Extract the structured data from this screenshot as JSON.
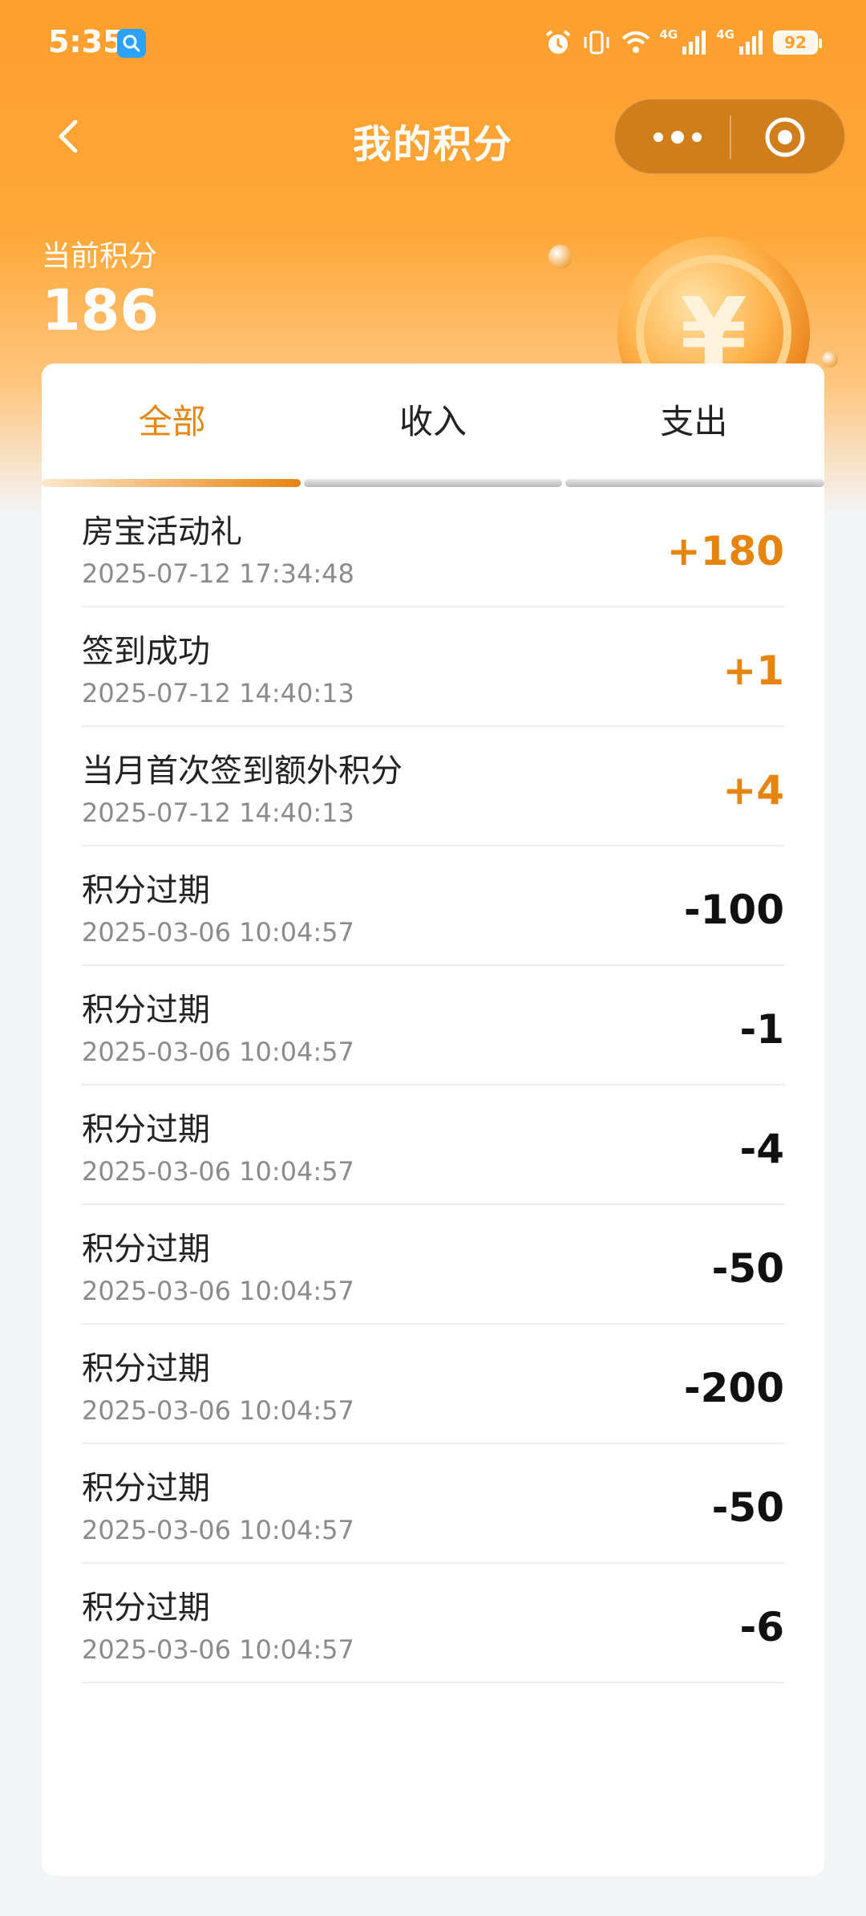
{
  "status_bar": {
    "time": "5:35",
    "network_1": "4G",
    "network_2": "4G",
    "battery": "92"
  },
  "nav": {
    "title": "我的积分"
  },
  "points": {
    "label": "当前积分",
    "value": "186"
  },
  "tabs": [
    {
      "label": "全部"
    },
    {
      "label": "收入"
    },
    {
      "label": "支出"
    }
  ],
  "records": [
    {
      "title": "房宝活动礼",
      "time": "2025-07-12 17:34:48",
      "amount": "+180"
    },
    {
      "title": "签到成功",
      "time": "2025-07-12 14:40:13",
      "amount": "+1"
    },
    {
      "title": "当月首次签到额外积分",
      "time": "2025-07-12 14:40:13",
      "amount": "+4"
    },
    {
      "title": "积分过期",
      "time": "2025-03-06 10:04:57",
      "amount": "-100"
    },
    {
      "title": "积分过期",
      "time": "2025-03-06 10:04:57",
      "amount": "-1"
    },
    {
      "title": "积分过期",
      "time": "2025-03-06 10:04:57",
      "amount": "-4"
    },
    {
      "title": "积分过期",
      "time": "2025-03-06 10:04:57",
      "amount": "-50"
    },
    {
      "title": "积分过期",
      "time": "2025-03-06 10:04:57",
      "amount": "-200"
    },
    {
      "title": "积分过期",
      "time": "2025-03-06 10:04:57",
      "amount": "-50"
    },
    {
      "title": "积分过期",
      "time": "2025-03-06 10:04:57",
      "amount": "-6"
    }
  ],
  "colors": {
    "accent": "#e68410",
    "header": "#ff9f2e"
  }
}
